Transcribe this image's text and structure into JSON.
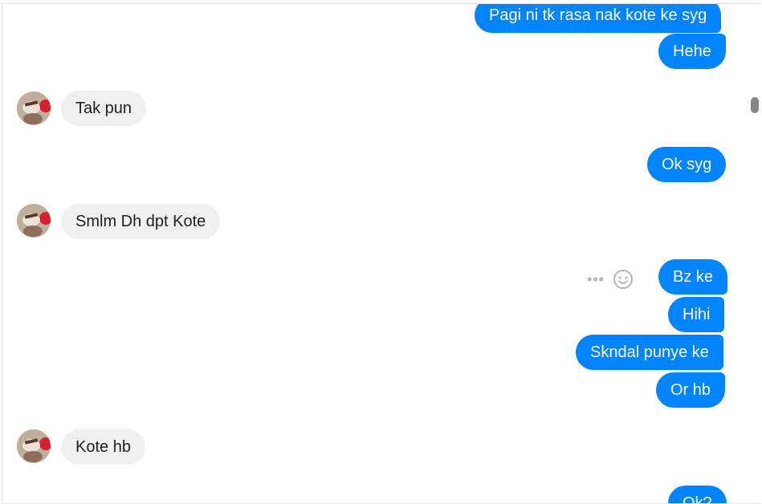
{
  "messages": [
    {
      "text": "Pagi ni tk rasa nak kote ke syg",
      "dir": "out"
    },
    {
      "text": "Hehe",
      "dir": "out"
    },
    {
      "text": "Tak pun",
      "dir": "in"
    },
    {
      "text": "Ok syg",
      "dir": "out"
    },
    {
      "text": "Smlm Dh dpt Kote",
      "dir": "in"
    },
    {
      "text": "Bz ke",
      "dir": "out"
    },
    {
      "text": "Hihi",
      "dir": "out"
    },
    {
      "text": "Skndal punye ke",
      "dir": "out"
    },
    {
      "text": "Or hb",
      "dir": "out"
    },
    {
      "text": "Kote hb",
      "dir": "in"
    },
    {
      "text": "Ok?",
      "dir": "out"
    }
  ],
  "icons": {
    "more": "more-options-icon",
    "react": "emoji-reaction-icon"
  },
  "colors": {
    "outgoing_bubble": "#0084ff",
    "incoming_bubble": "#f1f0f0",
    "outgoing_text": "#ffffff",
    "incoming_text": "#1c1e21"
  }
}
